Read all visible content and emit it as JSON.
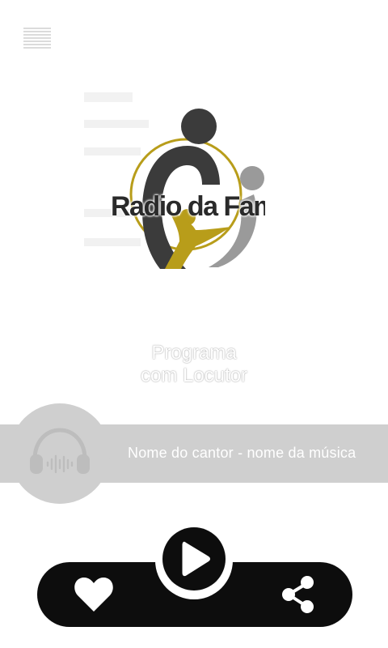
{
  "header": {
    "menu_icon": "menu-icon"
  },
  "logo": {
    "text": "Radio da Famíl"
  },
  "program": {
    "line1": "Programa",
    "line2": "com Locutor"
  },
  "now_playing": {
    "text": "Nome do cantor - nome da música",
    "avatar_icon": "headphones-icon"
  },
  "controls": {
    "like_icon": "heart-icon",
    "play_icon": "play-icon",
    "share_icon": "share-icon"
  },
  "colors": {
    "background": "#ffffff",
    "bar": "#cfcfcf",
    "controls": "#0d0d0d",
    "logo_gold": "#b89d1a",
    "logo_dark": "#3b3b3b",
    "logo_gray": "#9a9a9a"
  }
}
